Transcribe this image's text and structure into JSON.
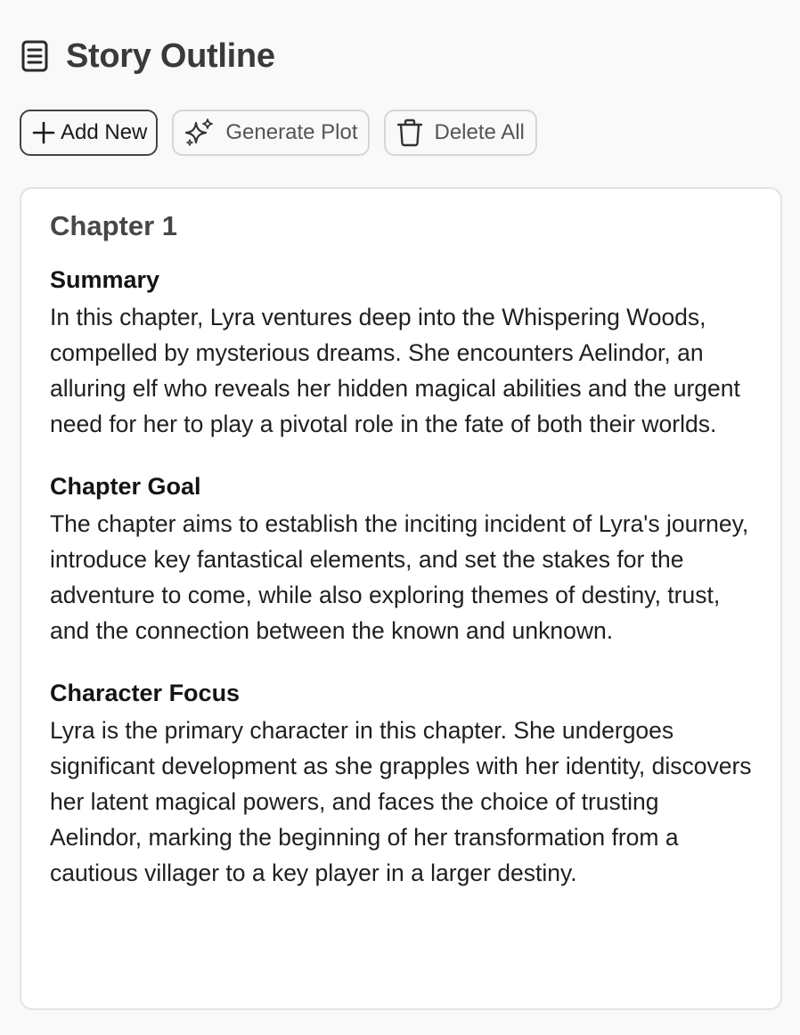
{
  "header": {
    "title": "Story Outline",
    "icon": "notebook-icon"
  },
  "toolbar": {
    "add_new_label": "Add New",
    "generate_plot_label": "Generate Plot",
    "delete_all_label": "Delete All"
  },
  "chapter": {
    "title": "Chapter 1",
    "sections": [
      {
        "heading": "Summary",
        "body": "In this chapter, Lyra ventures deep into the Whispering Woods, compelled by mysterious dreams. She encounters Aelindor, an alluring elf who reveals her hidden magical abilities and the urgent need for her to play a pivotal role in the fate of both their worlds."
      },
      {
        "heading": "Chapter Goal",
        "body": "The chapter aims to establish the inciting incident of Lyra's journey, introduce key fantastical elements, and set the stakes for the adventure to come, while also exploring themes of destiny, trust, and the connection between the known and unknown."
      },
      {
        "heading": "Character Focus",
        "body": "Lyra is the primary character in this chapter. She undergoes significant development as she grapples with her identity, discovers her latent magical powers, and faces the choice of trusting Aelindor, marking the beginning of her transformation from a cautious villager to a key player in a larger destiny."
      }
    ]
  }
}
